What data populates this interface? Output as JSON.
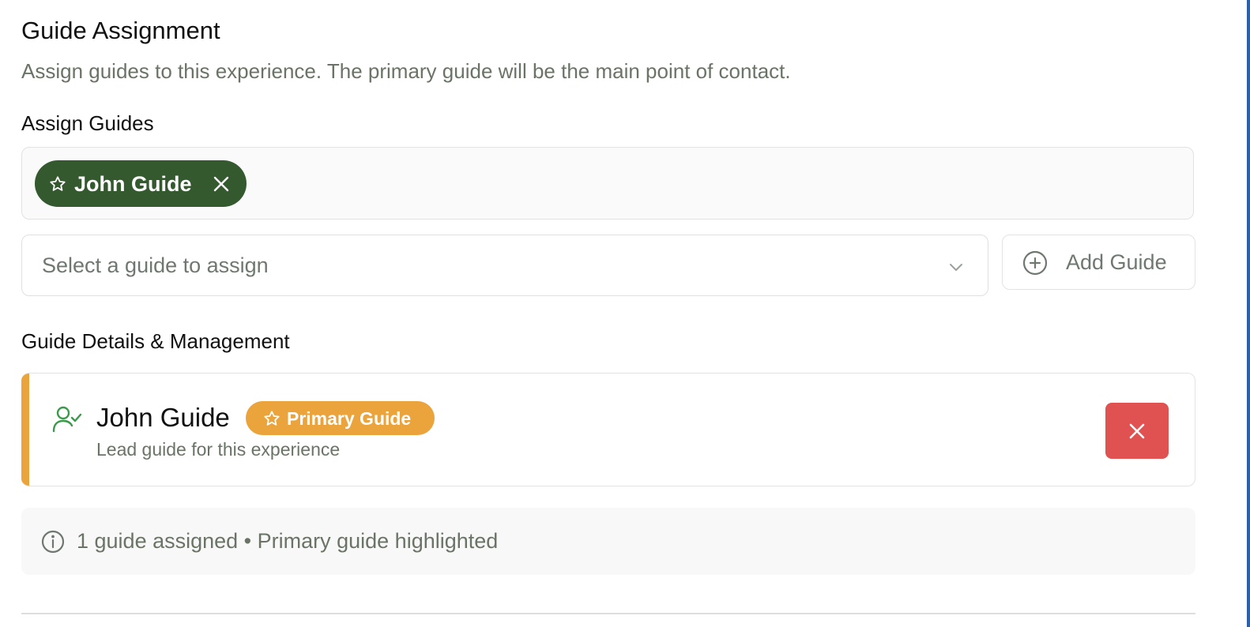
{
  "section": {
    "title": "Guide Assignment",
    "subtitle": "Assign guides to this experience. The primary guide will be the main point of contact."
  },
  "assign": {
    "label": "Assign Guides",
    "chips": [
      {
        "label": "John Guide",
        "icon": "star-icon",
        "remove_icon": "close-icon"
      }
    ],
    "select_placeholder": "Select a guide to assign",
    "add_button_label": "Add Guide"
  },
  "details": {
    "label": "Guide Details & Management",
    "guides": [
      {
        "name": "John Guide",
        "badge": "Primary Guide",
        "description": "Lead guide for this experience",
        "icon": "user-check-icon"
      }
    ]
  },
  "summary": {
    "text": "1 guide assigned • Primary guide highlighted",
    "icon": "info-icon"
  },
  "colors": {
    "chip_bg": "#35592f",
    "primary_badge": "#eba33c",
    "remove_button": "#e05252",
    "user_icon": "#3a9a4a"
  }
}
